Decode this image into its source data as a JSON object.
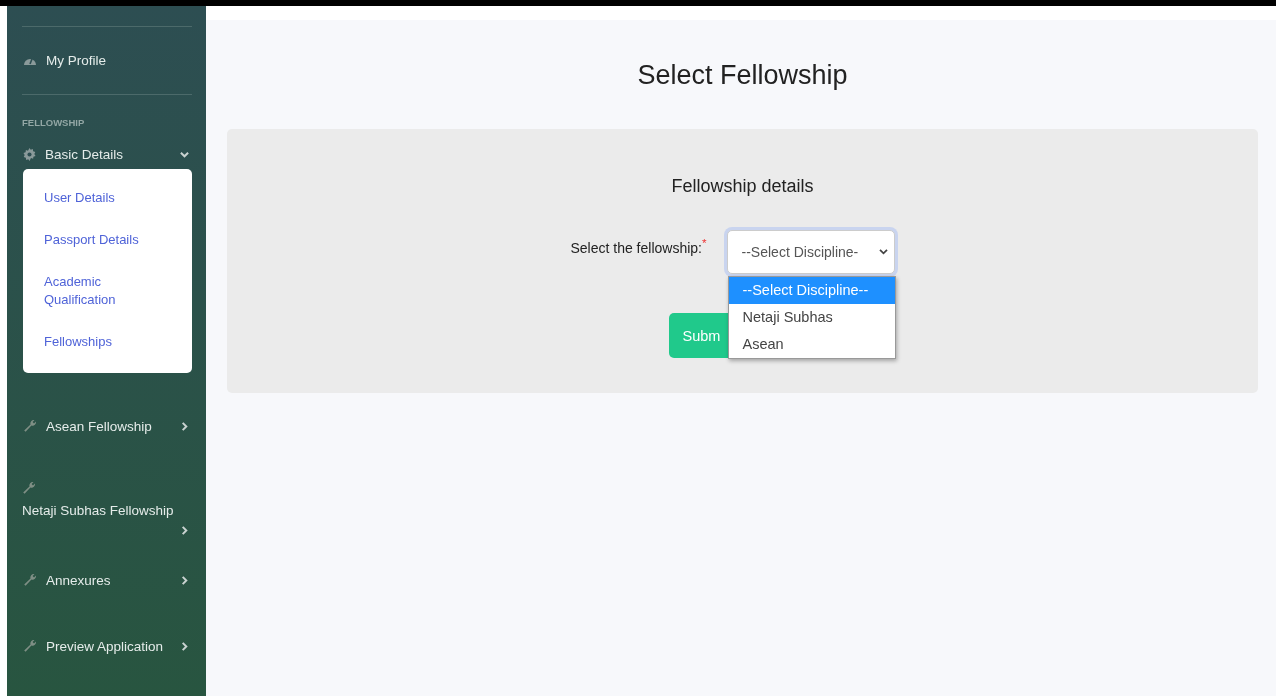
{
  "sidebar": {
    "items": [
      {
        "kind": "dashboard",
        "label": "My Profile"
      },
      {
        "kind": "heading",
        "label": "FELLOWSHIP"
      },
      {
        "kind": "settings",
        "label": "Basic Details",
        "expanded": true,
        "children": [
          {
            "label": "User Details"
          },
          {
            "label": "Passport Details"
          },
          {
            "label": "Academic Qualification"
          },
          {
            "label": "Fellowships"
          }
        ]
      },
      {
        "kind": "tool",
        "label": "Asean Fellowship",
        "expanded": false
      },
      {
        "kind": "tool",
        "label": "Netaji Subhas Fellowship",
        "expanded": false
      },
      {
        "kind": "tool",
        "label": "Annexures",
        "expanded": false
      },
      {
        "kind": "tool",
        "label": "Preview Application",
        "expanded": false
      }
    ]
  },
  "page": {
    "title": "Select Fellowship"
  },
  "form": {
    "title": "Fellowship details",
    "label": "Select the fellowship:",
    "required_mark": "*",
    "select": {
      "value": "--Select Discipline-",
      "open": true,
      "options": [
        {
          "label": "--Select Discipline--",
          "selected": true
        },
        {
          "label": "Netaji Subhas",
          "selected": false
        },
        {
          "label": "Asean",
          "selected": false
        }
      ]
    },
    "submit": "Subm"
  }
}
